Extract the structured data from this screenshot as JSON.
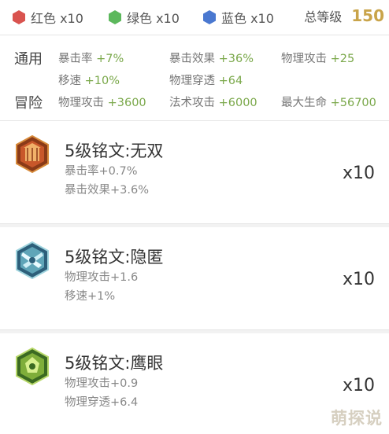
{
  "header": {
    "colors": [
      {
        "label": "红色 x10",
        "color": "#d9534f",
        "icon": "red-hex-icon"
      },
      {
        "label": "绿色 x10",
        "color": "#5cb85c",
        "icon": "green-hex-icon"
      },
      {
        "label": "蓝色 x10",
        "color": "#4a78d0",
        "icon": "blue-hex-icon"
      }
    ],
    "total_label": "总等级",
    "total_value": "150"
  },
  "summary": {
    "general_label": "通用",
    "adventure_label": "冒险",
    "general": [
      {
        "name": "暴击率",
        "value": "+7%"
      },
      {
        "name": "暴击效果",
        "value": "+36%"
      },
      {
        "name": "物理攻击",
        "value": "+25"
      },
      {
        "name": "移速",
        "value": "+10%"
      },
      {
        "name": "物理穿透",
        "value": "+64"
      }
    ],
    "adventure": [
      {
        "name": "物理攻击",
        "value": "+3600"
      },
      {
        "name": "法术攻击",
        "value": "+6000"
      },
      {
        "name": "最大生命",
        "value": "+56700"
      }
    ]
  },
  "runes": [
    {
      "title": "5级铭文:无双",
      "stats": [
        "暴击率+0.7%",
        "暴击效果+3.6%"
      ],
      "count": "x10",
      "color": "red",
      "icon": "red-rune-emblem-icon"
    },
    {
      "title": "5级铭文:隐匿",
      "stats": [
        "物理攻击+1.6",
        "移速+1%"
      ],
      "count": "x10",
      "color": "blue",
      "icon": "blue-rune-emblem-icon"
    },
    {
      "title": "5级铭文:鹰眼",
      "stats": [
        "物理攻击+0.9",
        "物理穿透+6.4"
      ],
      "count": "x10",
      "color": "green",
      "icon": "green-rune-emblem-icon"
    }
  ],
  "watermark": "萌探说"
}
